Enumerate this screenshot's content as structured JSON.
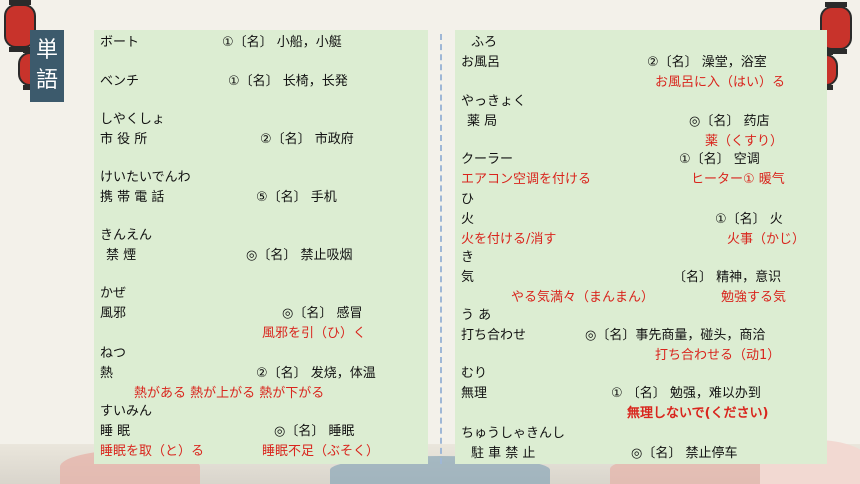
{
  "title": {
    "chars": [
      "単",
      "語"
    ]
  },
  "left": [
    {
      "reading": "",
      "word": "ボート",
      "meaning": "①〔名〕 小船，小艇",
      "examples": []
    },
    {
      "reading": "",
      "word": "ベンチ",
      "meaning": "①〔名〕 长椅，长発",
      "examples": []
    },
    {
      "reading": "しやくしょ",
      "word": "市 役 所",
      "meaning": "②〔名〕 市政府",
      "examples": []
    },
    {
      "reading": "けいたいでんわ",
      "word": "携 帯 電 話",
      "meaning": "⑤〔名〕 手机",
      "examples": []
    },
    {
      "reading": "きんえん",
      "word": "禁 煙",
      "meaning": "◎〔名〕 禁止吸烟",
      "examples": []
    },
    {
      "reading": "かぜ",
      "word": "風邪",
      "meaning": "◎〔名〕 感冒",
      "examples": [
        "風邪を引（ひ）く"
      ]
    },
    {
      "reading": "ねつ",
      "word": "熱",
      "meaning": "②〔名〕 发烧，体温",
      "examples": [
        "熱がある 熱が上がる 熱が下がる"
      ]
    },
    {
      "reading": "すいみん",
      "word": "睡 眠",
      "meaning": "◎〔名〕 睡眠",
      "examples": [
        "睡眠を取（と）る",
        "睡眠不足（ぶそく）"
      ]
    }
  ],
  "right": [
    {
      "reading": "ふろ",
      "word": "お風呂",
      "meaning": "②〔名〕 澡堂，浴室",
      "examples": [
        "お風呂に入（はい）る"
      ]
    },
    {
      "reading": "やっきょく",
      "word": "薬 局",
      "meaning": "◎〔名〕 药店",
      "examples": [
        "薬（くすり）"
      ]
    },
    {
      "reading": "",
      "word": "クーラー",
      "meaning": "①〔名〕 空调",
      "examples": [
        "エアコン空调を付ける",
        "ヒーター① 暖气"
      ]
    },
    {
      "reading": "ひ",
      "word": "火",
      "meaning": "①〔名〕 火",
      "examples": [
        "火を付ける/消す",
        "火事（かじ）"
      ]
    },
    {
      "reading": "き",
      "word": "気",
      "meaning": "〔名〕 精神，意识",
      "examples": [
        "やる気満々（まんまん）",
        "勉強する気"
      ]
    },
    {
      "reading": "う あ",
      "word": "打ち合わせ",
      "meaning": "◎〔名〕事先商量，碰头，商洽",
      "examples": [
        "打ち合わせる（动1）"
      ]
    },
    {
      "reading": "むり",
      "word": "無理",
      "meaning": "① 〔名〕 勉强，难以办到",
      "examples": [
        "無理しないで(ください)"
      ]
    },
    {
      "reading": "ちゅうしゃきんし",
      "word": "駐 車 禁 止",
      "meaning": "◎〔名〕 禁止停车",
      "examples": []
    }
  ]
}
